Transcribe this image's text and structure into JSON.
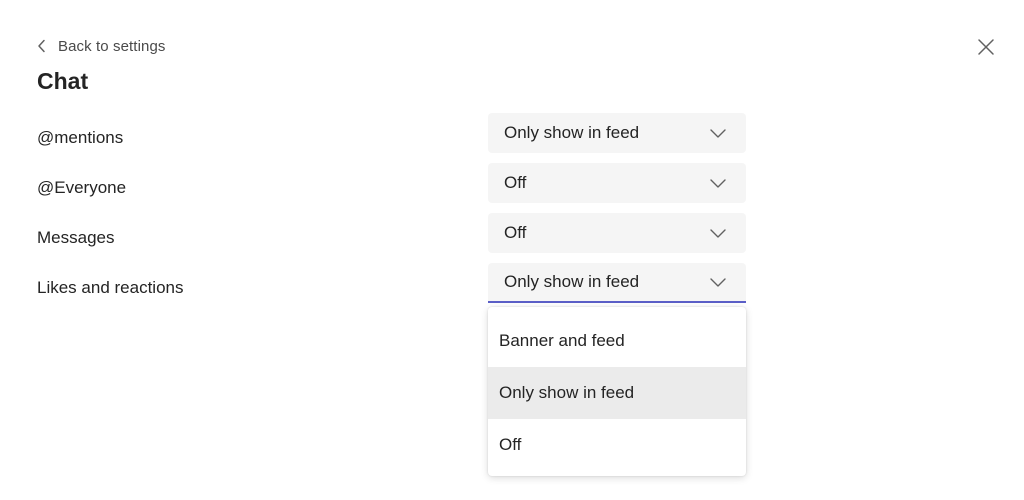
{
  "header": {
    "back_label": "Back to settings",
    "title": "Chat"
  },
  "icons": {
    "back": "chevron-left-icon",
    "close": "close-icon",
    "dropdown": "chevron-down-icon"
  },
  "colors": {
    "accent": "#5b5fc7",
    "select_bg": "#f5f5f5",
    "selected_option_bg": "#ebebeb"
  },
  "rows": [
    {
      "label": "@mentions",
      "value": "Only show in feed"
    },
    {
      "label": "@Everyone",
      "value": "Off"
    },
    {
      "label": "Messages",
      "value": "Off"
    },
    {
      "label": "Likes and reactions",
      "value": "Only show in feed"
    }
  ],
  "dropdown": {
    "open_row": 3,
    "options": [
      "Banner and feed",
      "Only show in feed",
      "Off"
    ],
    "selected": "Only show in feed"
  }
}
